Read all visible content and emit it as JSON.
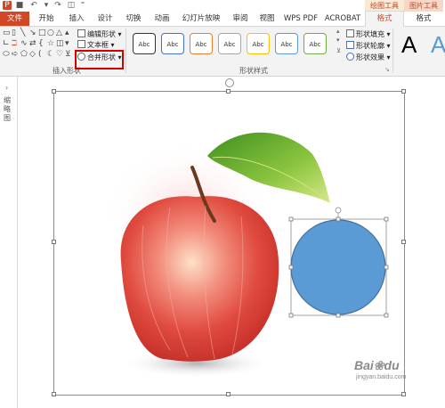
{
  "titlebar": {
    "context_tools": [
      "绘图工具",
      "图片工具"
    ]
  },
  "tabs": [
    "文件",
    "开始",
    "插入",
    "设计",
    "切换",
    "动画",
    "幻灯片放映",
    "审阅",
    "视图",
    "WPS PDF",
    "ACROBAT",
    "格式",
    "格式"
  ],
  "ribbon": {
    "insert_shapes": {
      "edit_shape": "编辑形状",
      "text_box": "文本框",
      "merge_shapes": "合并形状",
      "group_label": "插入形状"
    },
    "shape_styles": {
      "swatch_label": "Abc",
      "swatches": [
        "#333333",
        "#4472c4",
        "#ed7d31",
        "#a5a5a5",
        "#ffc000",
        "#5b9bd5",
        "#70ad47"
      ],
      "fill": "形状填充",
      "outline": "形状轮廓",
      "effects": "形状效果",
      "group_label": "形状样式"
    },
    "wordart": {
      "letter": "A",
      "colors": [
        "#000000",
        "#5b9bd5"
      ]
    }
  },
  "left_pane": {
    "label": "缩略图"
  },
  "slide": {
    "circle_color": "#5b9bd5",
    "apple_caption": ""
  },
  "watermark": {
    "text": "Bai",
    "paw": "du",
    "sub": "jingyan.baidu.com"
  }
}
